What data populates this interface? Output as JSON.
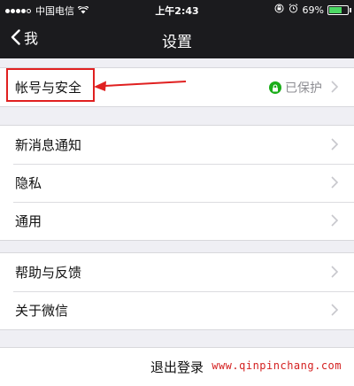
{
  "status_bar": {
    "carrier": "中国电信",
    "time": "上午2:43",
    "battery": "69%",
    "battery_level": 0.69,
    "signal_icon": "signal-dots-icon",
    "wifi_icon": "wifi-icon",
    "alarm_icon": "alarm-icon",
    "lock_icon": "orientation-lock-icon"
  },
  "nav": {
    "back_label": "我",
    "title": "设置"
  },
  "groups": [
    {
      "items": [
        {
          "label": "帐号与安全",
          "status": "已保护",
          "status_color": "#1aad19"
        }
      ]
    },
    {
      "items": [
        {
          "label": "新消息通知"
        },
        {
          "label": "隐私"
        },
        {
          "label": "通用"
        }
      ]
    },
    {
      "items": [
        {
          "label": "帮助与反馈"
        },
        {
          "label": "关于微信"
        }
      ]
    }
  ],
  "logout_label": "退出登录",
  "watermark": "www.qinpinchang.com",
  "colors": {
    "nav_bg": "#1b1b1e",
    "page_bg": "#efeff4",
    "annotation": "#e02020",
    "protected_green": "#1aad19"
  }
}
